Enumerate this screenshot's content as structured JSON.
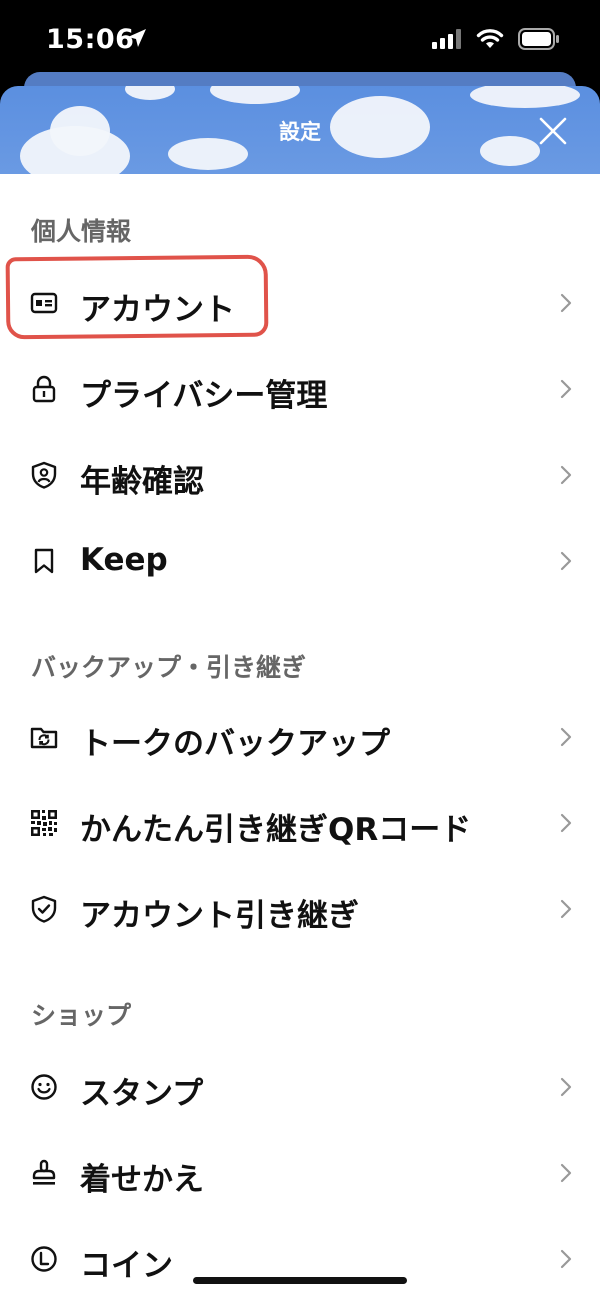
{
  "status_bar": {
    "time": "15:06",
    "location_icon": "location-arrow-icon",
    "signal_icon": "cellular-signal-icon",
    "wifi_icon": "wifi-icon",
    "battery_icon": "battery-icon"
  },
  "header": {
    "title": "設定",
    "close_icon": "close-icon",
    "background_color": "#5b8fe0"
  },
  "sections": [
    {
      "title": "個人情報",
      "items": [
        {
          "label": "アカウント",
          "icon": "id-card-icon",
          "highlighted": true
        },
        {
          "label": "プライバシー管理",
          "icon": "lock-icon"
        },
        {
          "label": "年齢確認",
          "icon": "shield-person-icon"
        },
        {
          "label": "Keep",
          "icon": "bookmark-icon"
        }
      ]
    },
    {
      "title": "バックアップ・引き継ぎ",
      "items": [
        {
          "label": "トークのバックアップ",
          "icon": "folder-sync-icon"
        },
        {
          "label": "かんたん引き継ぎQRコード",
          "icon": "qr-code-icon"
        },
        {
          "label": "アカウント引き継ぎ",
          "icon": "shield-check-icon"
        }
      ]
    },
    {
      "title": "ショップ",
      "items": [
        {
          "label": "スタンプ",
          "icon": "smiley-icon"
        },
        {
          "label": "着せかえ",
          "icon": "stamp-icon"
        },
        {
          "label": "コイン",
          "icon": "coin-icon"
        }
      ]
    }
  ],
  "highlight_color": "#e0534a"
}
